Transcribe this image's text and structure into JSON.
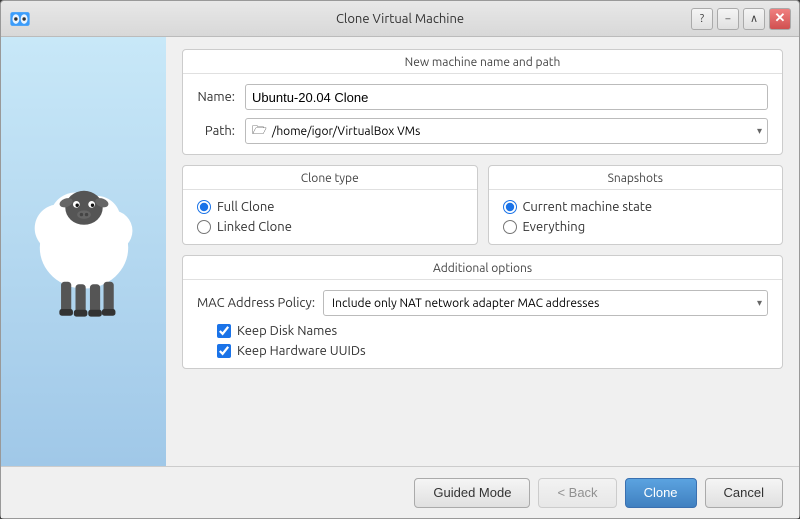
{
  "titlebar": {
    "title": "Clone Virtual Machine",
    "logo_label": "VirtualBox logo",
    "help_btn": "?",
    "minimize_btn": "−",
    "maximize_btn": "∧",
    "close_btn": "✕"
  },
  "name_section": {
    "title": "New machine name and path",
    "name_label": "Name:",
    "name_value": "Ubuntu-20.04 Clone",
    "path_label": "Path:",
    "path_value": "/home/igor/VirtualBox VMs",
    "path_icon": "🗁"
  },
  "clone_type": {
    "title": "Clone type",
    "options": [
      {
        "label": "Full Clone",
        "value": "full",
        "checked": true
      },
      {
        "label": "Linked Clone",
        "value": "linked",
        "checked": false
      }
    ]
  },
  "snapshots": {
    "title": "Snapshots",
    "options": [
      {
        "label": "Current machine state",
        "value": "current",
        "checked": true
      },
      {
        "label": "Everything",
        "value": "everything",
        "checked": false
      }
    ]
  },
  "additional_options": {
    "title": "Additional options",
    "mac_policy_label": "MAC Address Policy:",
    "mac_policy_value": "Include only NAT network adapter MAC addresses",
    "checkboxes": [
      {
        "label": "Keep Disk Names",
        "checked": true
      },
      {
        "label": "Keep Hardware UUIDs",
        "checked": true
      }
    ]
  },
  "footer": {
    "guided_mode_label": "Guided Mode",
    "back_label": "< Back",
    "clone_label": "Clone",
    "cancel_label": "Cancel"
  }
}
